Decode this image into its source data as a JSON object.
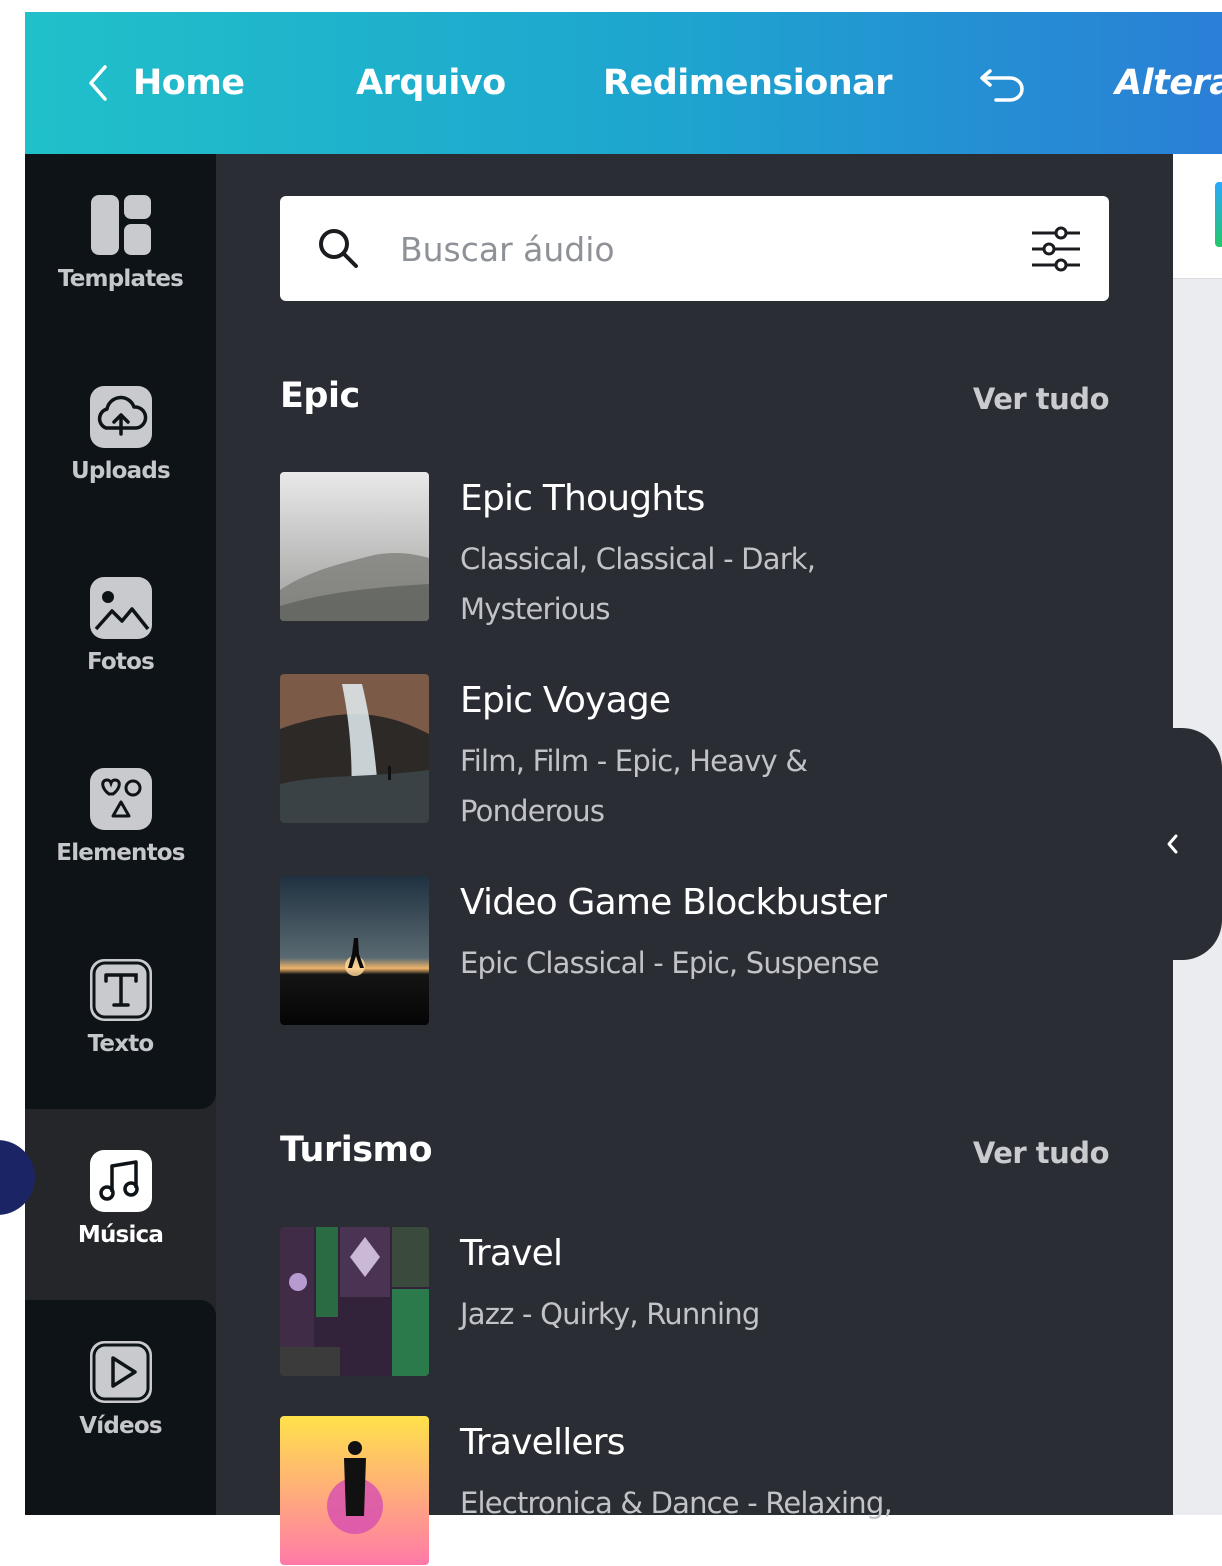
{
  "header": {
    "home_label": "Home",
    "file_label": "Arquivo",
    "resize_label": "Redimensionar",
    "more_label": "Altera"
  },
  "sidebar": {
    "items": [
      {
        "label": "Templates",
        "icon": "templates-icon"
      },
      {
        "label": "Uploads",
        "icon": "cloud-upload-icon"
      },
      {
        "label": "Fotos",
        "icon": "photo-icon"
      },
      {
        "label": "Elementos",
        "icon": "shapes-icon"
      },
      {
        "label": "Texto",
        "icon": "text-icon"
      },
      {
        "label": "Música",
        "icon": "music-icon",
        "active": true
      },
      {
        "label": "Vídeos",
        "icon": "play-icon"
      }
    ]
  },
  "search": {
    "placeholder": "Buscar áudio"
  },
  "sections": [
    {
      "title": "Epic",
      "see_all": "Ver tudo",
      "tracks": [
        {
          "title": "Epic Thoughts",
          "tags": "Classical, Classical - Dark, Mysterious"
        },
        {
          "title": "Epic Voyage",
          "tags": "Film, Film - Epic, Heavy & Ponderous"
        },
        {
          "title": "Video Game Blockbuster",
          "tags": "Epic Classical - Epic, Suspense"
        }
      ]
    },
    {
      "title": "Turismo",
      "see_all": "Ver tudo",
      "tracks": [
        {
          "title": "Travel",
          "tags": "Jazz - Quirky, Running"
        },
        {
          "title": "Travellers",
          "tags": "Electronica & Dance - Relaxing,"
        }
      ]
    }
  ],
  "colors": {
    "header_start": "#20c0c9",
    "header_end": "#2a7fd6",
    "rail_bg": "#0e1318",
    "panel_bg": "#2a2d34"
  }
}
